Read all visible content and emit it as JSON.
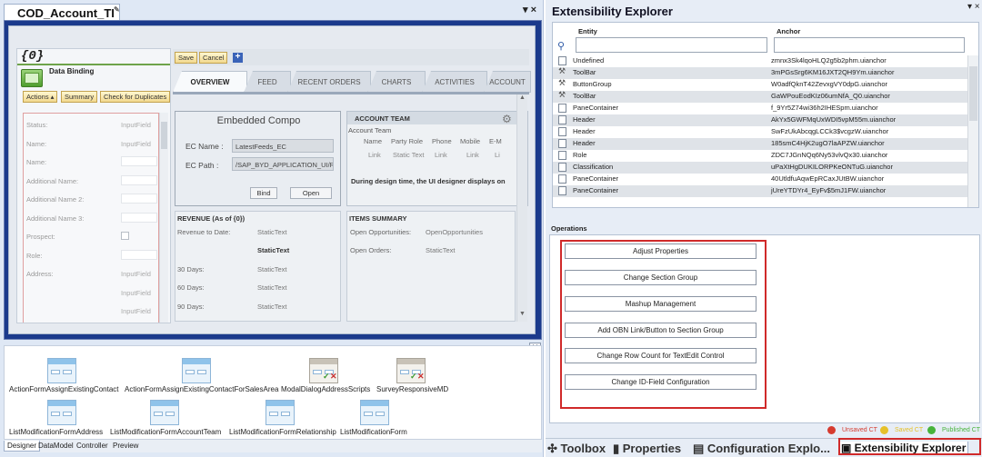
{
  "left_doc": {
    "tab_title": "COD_Account_TI",
    "close_glyph": "▾ ×"
  },
  "data_panel": {
    "title": "{0}",
    "subtitle": "Data Binding",
    "toolbar": [
      "Actions ▴",
      "Summary",
      "Check for Duplicates"
    ],
    "fields": [
      {
        "label": "Status:",
        "value": "InputField",
        "kind": "plain"
      },
      {
        "label": "Name:",
        "value": "InputField",
        "kind": "plain"
      },
      {
        "label": "Name:",
        "value": "",
        "kind": "box"
      },
      {
        "label": "Additional Name:",
        "value": "",
        "kind": "box"
      },
      {
        "label": "Additional Name 2:",
        "value": "",
        "kind": "box"
      },
      {
        "label": "Additional Name 3:",
        "value": "",
        "kind": "box"
      },
      {
        "label": "Prospect:",
        "value": "",
        "kind": "checkbox"
      },
      {
        "label": "Role:",
        "value": "",
        "kind": "box"
      },
      {
        "label": "Address:",
        "value": "InputField",
        "kind": "plain"
      },
      {
        "label": "",
        "value": "InputField",
        "kind": "plain"
      },
      {
        "label": "",
        "value": "InputField",
        "kind": "plain"
      }
    ]
  },
  "canvas_toolbar": {
    "save": "Save",
    "cancel": "Cancel",
    "add": "+"
  },
  "tabs": [
    "OVERVIEW",
    "FEED",
    "RECENT ORDERS",
    "CHARTS",
    "ACTIVITIES",
    "ACCOUNT"
  ],
  "embedded": {
    "title": "Embedded Compo",
    "name_label": "EC Name :",
    "name_value": "LatestFeeds_EC",
    "path_label": "EC Path :",
    "path_value": "/SAP_BYD_APPLICATION_UI/Re",
    "bind": "Bind",
    "open": "Open"
  },
  "account_team": {
    "header": "ACCOUNT TEAM",
    "sub": "Account Team",
    "columns": [
      "Name",
      "Party Role",
      "Phone",
      "Mobile",
      "E-M"
    ],
    "cells": [
      "Link",
      "Static Text",
      "Link",
      "Link",
      "Li"
    ],
    "note": "During design time, the UI designer displays on"
  },
  "revenue": {
    "title": "REVENUE (As of {0})",
    "rows": [
      {
        "label": "Revenue to Date:",
        "value": "StaticText",
        "bold": false
      },
      {
        "label": "",
        "value": "StaticText",
        "bold": true
      },
      {
        "label": "30 Days:",
        "value": "StaticText",
        "bold": false
      },
      {
        "label": "60 Days:",
        "value": "StaticText",
        "bold": false
      },
      {
        "label": "90 Days:",
        "value": "StaticText",
        "bold": false
      }
    ]
  },
  "items_summary": {
    "title": "ITEMS SUMMARY",
    "rows": [
      {
        "label": "Open Opportunities:",
        "value": "OpenOpportunities"
      },
      {
        "label": "Open Orders:",
        "value": "StaticText"
      }
    ]
  },
  "gallery": [
    {
      "label": "ActionFormAssignExistingContact",
      "icon": "form-icon"
    },
    {
      "label": "ActionFormAssignExistingContactForSalesArea",
      "icon": "form-icon"
    },
    {
      "label": "ModalDialogAddressScripts",
      "icon": "modal-dialog-icon"
    },
    {
      "label": "SurveyResponsiveMD",
      "icon": "modal-dialog-icon"
    },
    {
      "label": "ListModificationFormAddress",
      "icon": "form-icon"
    },
    {
      "label": "ListModificationFormAccountTeam",
      "icon": "form-icon"
    },
    {
      "label": "ListModificationFormRelationship",
      "icon": "form-icon"
    },
    {
      "label": "ListModificationForm",
      "icon": "form-icon"
    }
  ],
  "bottom_tabs": [
    "Designer",
    "DataModel",
    "Controller",
    "Preview"
  ],
  "explorer": {
    "title": "Extensibility Explorer",
    "pin": "▾ ×",
    "col_entity": "Entity",
    "col_anchor": "Anchor",
    "rows": [
      {
        "entity": "Undefined",
        "anchor": "zmnx3Sk4lqoHLQ2g5b2phm.uianchor",
        "icon": "page-icon"
      },
      {
        "entity": "ToolBar",
        "anchor": "3mPGsSrg6KM16JXT2QH9Ym.uianchor",
        "icon": "tool-icon"
      },
      {
        "entity": "ButtonGroup",
        "anchor": "W0adfQknT42ZevxgVY0dpG.uianchor",
        "icon": "tool-icon"
      },
      {
        "entity": "ToolBar",
        "anchor": "GaWPouEodKIz06umNfA_Q0.uianchor",
        "icon": "tool-icon"
      },
      {
        "entity": "PaneContainer",
        "anchor": "f_9Yr5Z74wi36h2IHESpm.uianchor",
        "icon": "page-icon"
      },
      {
        "entity": "Header",
        "anchor": "AkYx5GWFMqUxWDI5vpM55m.uianchor",
        "icon": "page-icon"
      },
      {
        "entity": "Header",
        "anchor": "SwFzUkAbcqgLCCk3$vcgzW.uianchor",
        "icon": "page-icon"
      },
      {
        "entity": "Header",
        "anchor": "185smC4HjK2ugO7laAPZW.uianchor",
        "icon": "page-icon"
      },
      {
        "entity": "Role",
        "anchor": "ZDC7JGnNQq6Ny53vlvQx30.uianchor",
        "icon": "page-icon"
      },
      {
        "entity": "Classification",
        "anchor": "uPaXtHgDUKILORPKeONTuG.uianchor",
        "icon": "page-icon"
      },
      {
        "entity": "PaneContainer",
        "anchor": "40UtldfuAqwEpRCaxJUtBW.uianchor",
        "icon": "page-icon"
      },
      {
        "entity": "PaneContainer",
        "anchor": "jUreYTDYr4_EyFv$5mJ1FW.uianchor",
        "icon": "page-icon"
      }
    ],
    "ops_label": "Operations",
    "operations": [
      "Adjust Properties",
      "Change Section Group",
      "Mashup Management",
      "Add OBN Link/Button to Section Group",
      "Change Row Count for TextEdit Control",
      "Change ID-Field Configuration"
    ],
    "legend": [
      {
        "text": "Unsaved CT",
        "color": "#d63b2f"
      },
      {
        "text": "Saved CT",
        "color": "#e6c12a"
      },
      {
        "text": "Published CT",
        "color": "#47b33a"
      }
    ],
    "tabs": [
      "Toolbox",
      "Properties",
      "Configuration Explo...",
      "Extensibility Explorer"
    ]
  }
}
